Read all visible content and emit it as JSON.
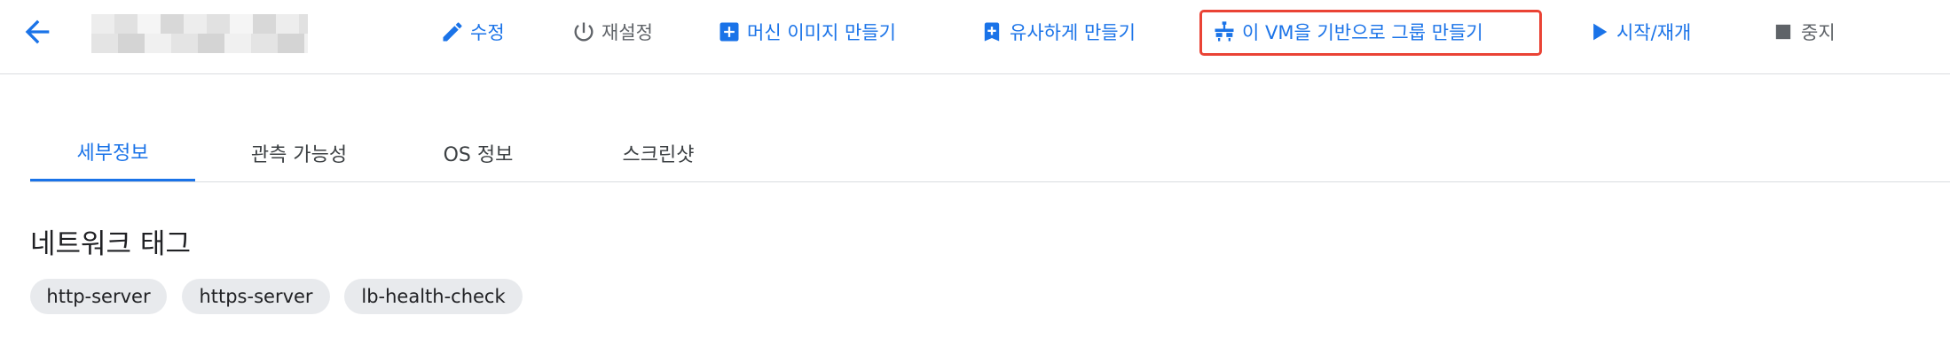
{
  "header": {
    "back_icon": "arrow-back-icon",
    "title": "",
    "actions": [
      {
        "label": "수정",
        "icon": "pencil-icon",
        "color": "#1a73e8"
      },
      {
        "label": "재설정",
        "icon": "power-icon",
        "color": "#5f6368"
      },
      {
        "label": "머신 이미지 만들기",
        "icon": "add-box-icon",
        "color": "#1a73e8"
      },
      {
        "label": "유사하게 만들기",
        "icon": "add-bookmark-icon",
        "color": "#1a73e8"
      },
      {
        "label": "이 VM을 기반으로 그룹 만들기",
        "icon": "instance-group-icon",
        "color": "#1a73e8",
        "highlighted": true
      },
      {
        "label": "시작/재개",
        "icon": "play-icon",
        "color": "#1a73e8"
      },
      {
        "label": "중지",
        "icon": "stop-icon",
        "color": "#5f6368"
      }
    ]
  },
  "tabs": [
    {
      "label": "세부정보",
      "active": true
    },
    {
      "label": "관측 가능성",
      "active": false
    },
    {
      "label": "OS 정보",
      "active": false
    },
    {
      "label": "스크린샷",
      "active": false
    }
  ],
  "section": {
    "title": "네트워크 태그",
    "tags": [
      "http-server",
      "https-server",
      "lb-health-check"
    ]
  },
  "colors": {
    "accent": "#1a73e8",
    "highlight_border": "#ea4335",
    "chip_bg": "#e8eaed"
  }
}
